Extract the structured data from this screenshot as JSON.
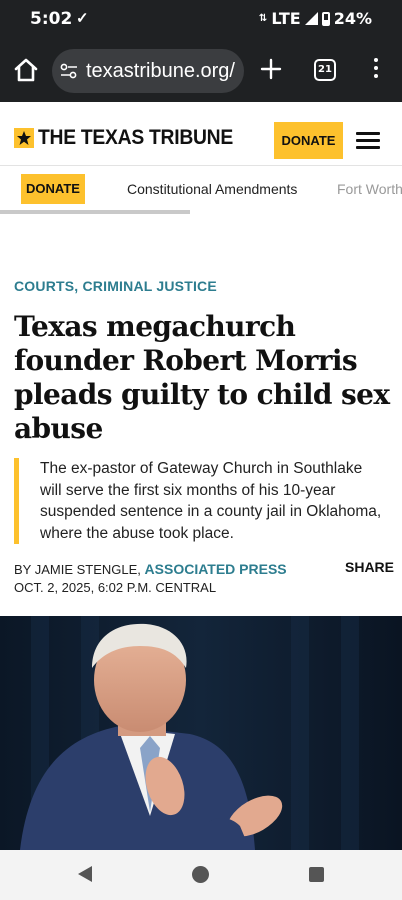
{
  "status_bar": {
    "time": "5:02",
    "check_glyph": "✓",
    "network": "LTE",
    "battery": "24%"
  },
  "browser": {
    "url": "texastribune.org/",
    "tab_count": "21",
    "icons": [
      "home-icon",
      "site-settings-icon",
      "new-tab-icon",
      "tab-switcher-icon",
      "more-options-icon"
    ]
  },
  "site_header": {
    "logo_text": "THE TEXAS TRIBUNE",
    "donate_label": "DONATE",
    "accent_color": "#fdc12d"
  },
  "subnav": {
    "donate_label": "DONATE",
    "items": [
      "Constitutional Amendments",
      "Fort Worth"
    ]
  },
  "article": {
    "kicker": "COURTS, CRIMINAL JUSTICE",
    "kicker_color": "#2d7d8f",
    "headline": "Texas megachurch founder Robert Morris pleads guilty to child sex abuse",
    "dek": "The ex-pastor of Gateway Church in Southlake will serve the first six months of his 10-year suspended sentence in a county jail in Oklahoma, where the abuse took place.",
    "byline_prefix": "BY JAMIE STENGLE, ",
    "byline_org": "ASSOCIATED PRESS",
    "dateline": "OCT. 2, 2025, 6:02 P.M. CENTRAL",
    "share_label": "SHARE"
  },
  "system_nav": {
    "icons": [
      "back-icon",
      "home-icon",
      "recents-icon"
    ]
  }
}
